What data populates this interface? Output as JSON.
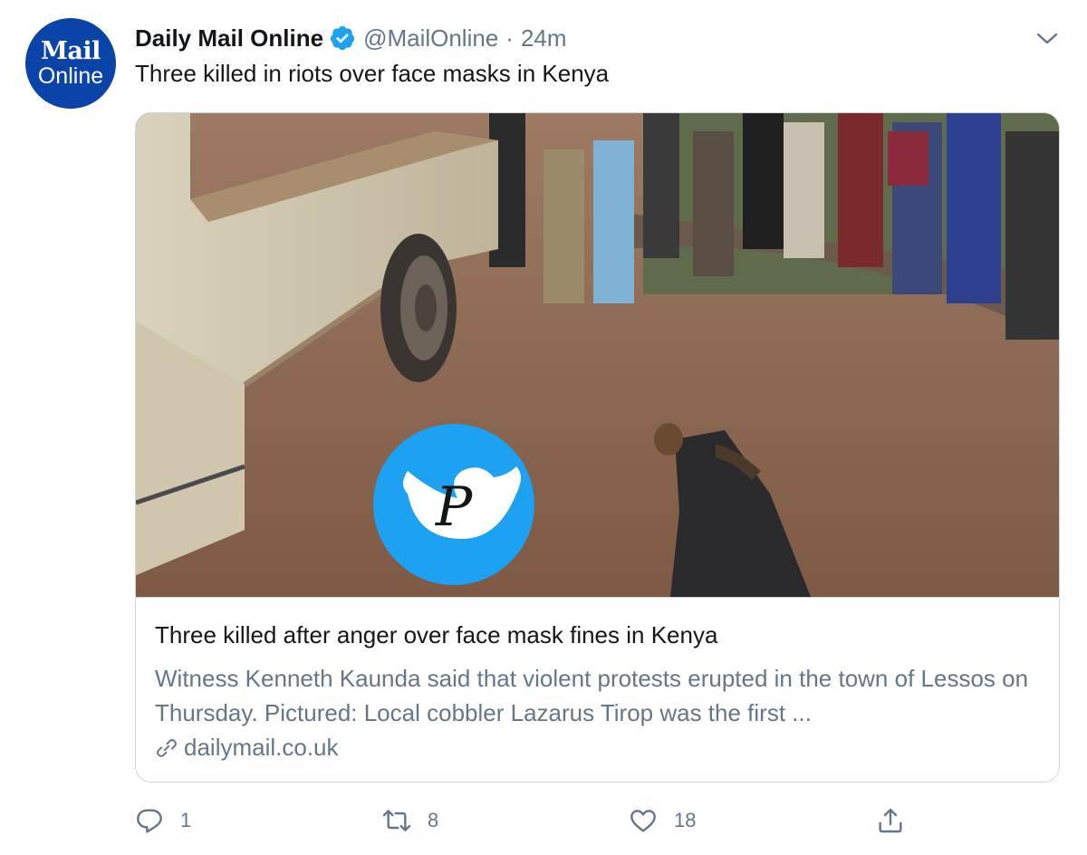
{
  "account": {
    "avatar_line1": "Mail",
    "avatar_line2": "Online",
    "name": "Daily Mail Online",
    "handle": "@MailOnline",
    "separator": "·",
    "time": "24m"
  },
  "tweet": {
    "text": "Three killed in riots over face masks in Kenya"
  },
  "card": {
    "title": "Three killed after anger over face mask fines in Kenya",
    "description": "Witness Kenneth Kaunda said that violent protests erupted in the town of Lessos on Thursday. Pictured: Local cobbler Lazarus Tirop was the first ...",
    "domain": "dailymail.co.uk",
    "watermark_letter": "P"
  },
  "actions": {
    "reply_count": "1",
    "retweet_count": "8",
    "like_count": "18"
  },
  "colors": {
    "avatar_bg": "#0a44a8",
    "verified": "#1da1f2",
    "secondary_text": "#657786",
    "border": "#ccd6dd",
    "watermark_bg": "#1da1f2"
  },
  "icons": {
    "verified": "verified-badge-icon",
    "more": "chevron-down-icon",
    "link": "link-icon",
    "reply": "reply-icon",
    "retweet": "retweet-icon",
    "like": "heart-icon",
    "share": "share-icon"
  }
}
